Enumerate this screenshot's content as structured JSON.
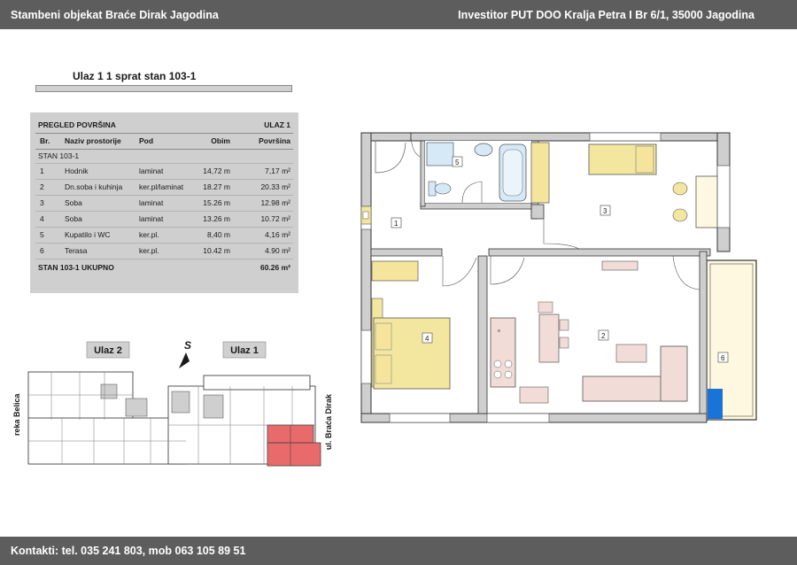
{
  "header": {
    "left": "Stambeni objekat Braće Dirak  Jagodina",
    "right": "Investitor PUT DOO Kralja Petra I Br 6/1, 35000 Jagodina"
  },
  "unit_title": "Ulaz 1 1 sprat stan 103-1",
  "table": {
    "title": "PREGLED POVRŠINA",
    "entrance": "ULAZ 1",
    "columns": [
      "Br.",
      "Naziv prostorije",
      "Pod",
      "Obim",
      "Površina"
    ],
    "section": "STAN 103-1",
    "rows": [
      {
        "no": "1",
        "name": "Hodnik",
        "floor": "laminat",
        "perimeter": "14,72 m",
        "area": "7,17 m²"
      },
      {
        "no": "2",
        "name": "Dn.soba i kuhinja",
        "floor": "ker.pl/laminat",
        "perimeter": "18.27 m",
        "area": "20.33 m²"
      },
      {
        "no": "3",
        "name": "Soba",
        "floor": "laminat",
        "perimeter": "15.26 m",
        "area": "12.98 m²"
      },
      {
        "no": "4",
        "name": "Soba",
        "floor": "laminat",
        "perimeter": "13.26 m",
        "area": "10.72 m²"
      },
      {
        "no": "5",
        "name": "Kupatilo i WC",
        "floor": "ker.pl.",
        "perimeter": "8,40 m",
        "area": "4,16 m²"
      },
      {
        "no": "6",
        "name": "Terasa",
        "floor": "ker.pl.",
        "perimeter": "10.42 m",
        "area": "4.90 m²"
      }
    ],
    "total_label": "STAN 103-1   UKUPNO",
    "total_value": "60.26 m²"
  },
  "floorplan": {
    "room_labels": [
      "1",
      "2",
      "3",
      "4",
      "5",
      "6"
    ],
    "stove_label": "o"
  },
  "site_plan": {
    "entrance_left": "Ulaz 2",
    "entrance_right": "Ulaz 1",
    "north_label": "S",
    "street_left": "reka Belica",
    "street_right": "ul. Braća Dirak"
  },
  "footer": {
    "contact": "Kontakti: tel. 035 241 803, mob 063 105 89 51"
  },
  "colors": {
    "bar": "#5d5d5d",
    "table_bg": "#cfcfcf",
    "bed_yellow": "#f3e7a0",
    "cabinet_yellow": "#f5e59c",
    "kitchen_pink": "#f1dcd7",
    "bath_blue": "#d6e9f7",
    "terrace_cream": "#fdf8df",
    "highlight_red": "#e96a6a",
    "accent_blue": "#1a73d9"
  }
}
